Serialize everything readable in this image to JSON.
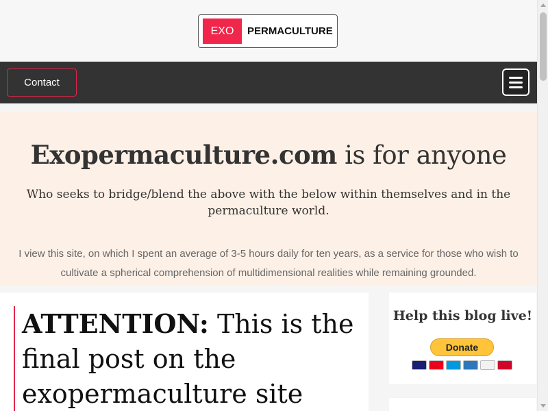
{
  "header": {
    "logo_exo": "EXO",
    "logo_permaculture": "PERMACULTURE"
  },
  "nav": {
    "contact_label": "Contact",
    "menu_icon": "hamburger-menu-icon"
  },
  "hero": {
    "title_strong": "Exopermaculture.com",
    "title_rest": " is for anyone",
    "subtitle": "Who seeks to bridge/blend the above with the below within themselves and in the permaculture world.",
    "description": "I view this site, on which I spent an average of 3-5 hours daily for ten years, as a service for those who wish to cultivate a spherical comprehension of multidimensional realities while remaining grounded."
  },
  "post": {
    "title_strong": "ATTENTION:",
    "title_rest": " This is the final post on the exopermaculture site"
  },
  "sidebar": {
    "donate_title": "Help this blog live!",
    "donate_label": "Donate",
    "cards": [
      {
        "label": "VISA",
        "color": "#1a1f71"
      },
      {
        "label": "MC",
        "color": "#eb001b"
      },
      {
        "label": "MAESTRO",
        "color": "#0099df"
      },
      {
        "label": "AMEX",
        "color": "#2e77bc"
      },
      {
        "label": "DISCOVER",
        "color": "#f2f2f2"
      },
      {
        "label": "UNIONPAY",
        "color": "#d10429"
      }
    ]
  },
  "colors": {
    "accent": "#e0264b",
    "nav_bg": "#333333",
    "hero_bg": "#fdf0e6",
    "donate_yellow": "#ffc439"
  }
}
